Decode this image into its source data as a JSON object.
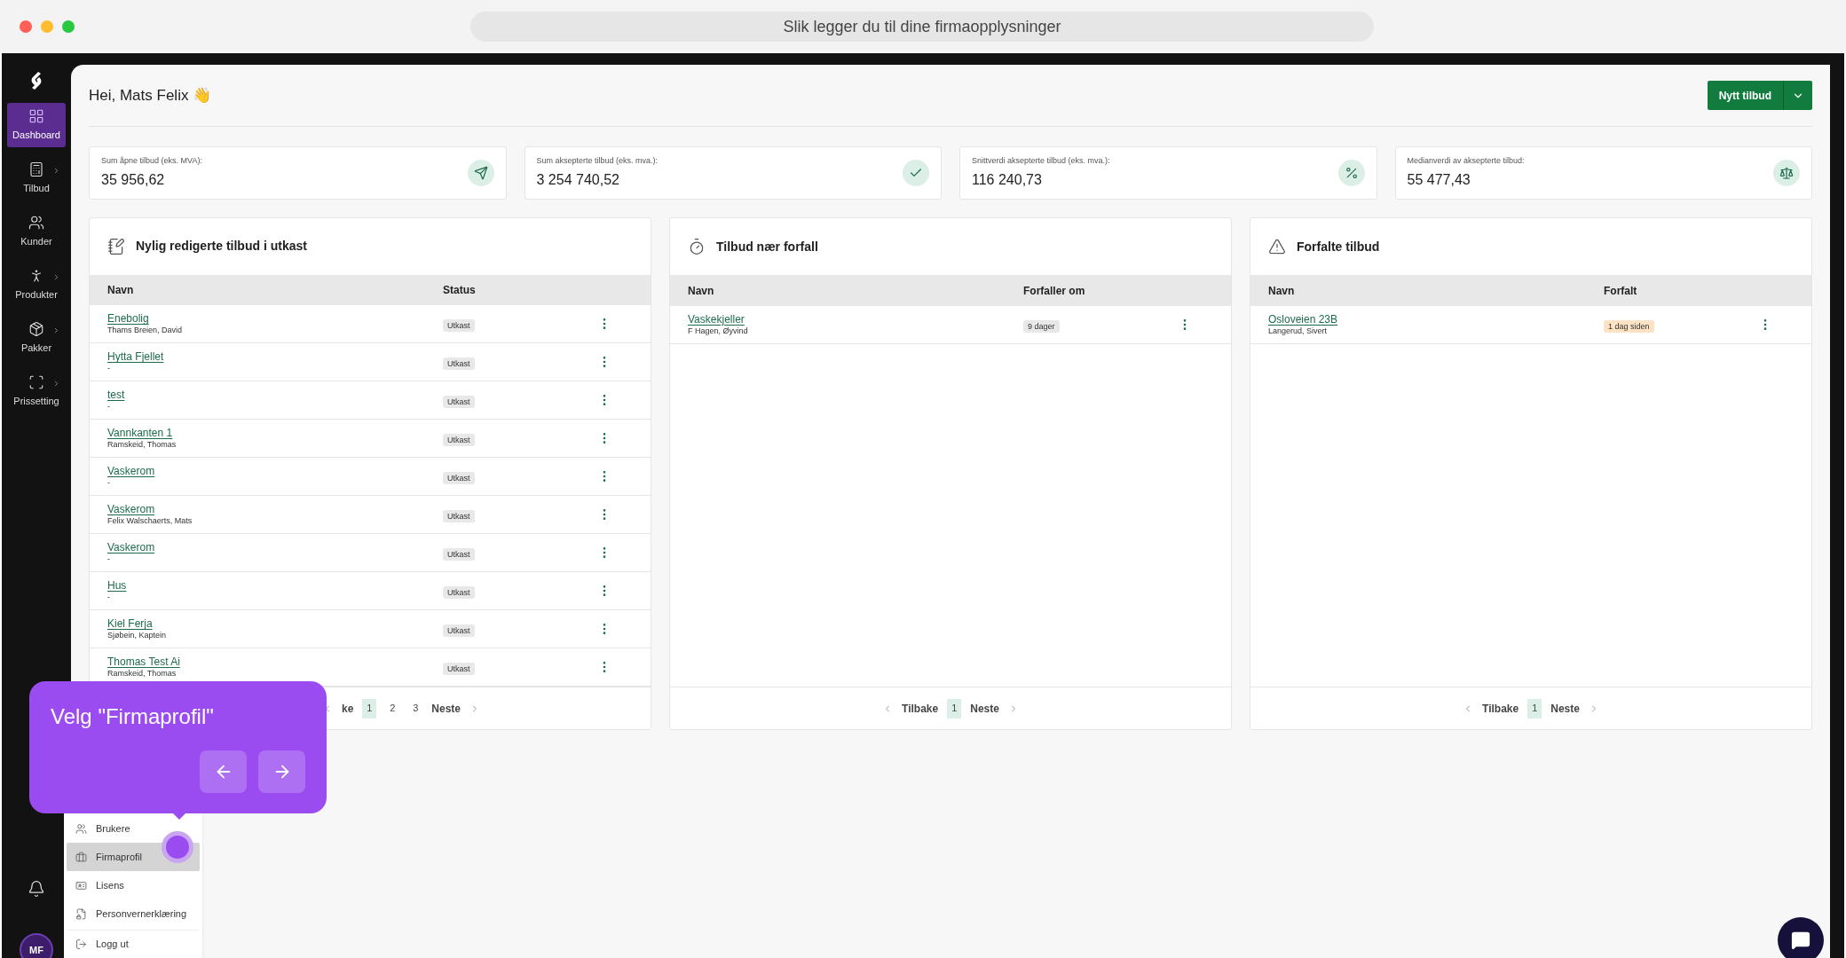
{
  "browser": {
    "address": "Slik legger du til dine firmaopplysninger"
  },
  "sidebar": {
    "items": [
      {
        "label": "Dashboard",
        "selected": true,
        "has_submenu": false
      },
      {
        "label": "Tilbud",
        "selected": false,
        "has_submenu": true
      },
      {
        "label": "Kunder",
        "selected": false,
        "has_submenu": false
      },
      {
        "label": "Produkter",
        "selected": false,
        "has_submenu": true
      },
      {
        "label": "Pakker",
        "selected": false,
        "has_submenu": true
      },
      {
        "label": "Prissetting",
        "selected": false,
        "has_submenu": true
      }
    ],
    "avatar": "MF"
  },
  "header": {
    "greeting": "Hei, Mats Felix 👋",
    "primary_button": "Nytt tilbud"
  },
  "stats": [
    {
      "label": "Sum åpne tilbud (eks. MVA):",
      "value": "35 956,62"
    },
    {
      "label": "Sum aksepterte tilbud (eks. mva.):",
      "value": "3 254 740,52"
    },
    {
      "label": "Snittverdi aksepterte tilbud (eks. mva.):",
      "value": "116 240,73"
    },
    {
      "label": "Medianverdi av aksepterte tilbud:",
      "value": "55 477,43"
    }
  ],
  "tables": [
    {
      "title": "Nylig redigerte tilbud i utkast",
      "columns": [
        "Navn",
        "Status"
      ],
      "rows": [
        {
          "name": "Enebolig",
          "sub": "Thams Breien, David",
          "status": "Utkast",
          "color": "#e8e8e8"
        },
        {
          "name": "Hytta Fjellet",
          "sub": "-",
          "status": "Utkast",
          "color": "#e8e8e8"
        },
        {
          "name": "test",
          "sub": "-",
          "status": "Utkast",
          "color": "#e8e8e8"
        },
        {
          "name": "Vannkanten 1",
          "sub": "Ramskeid, Thomas",
          "status": "Utkast",
          "color": "#e8e8e8"
        },
        {
          "name": "Vaskerom",
          "sub": "-",
          "status": "Utkast",
          "color": "#e8e8e8"
        },
        {
          "name": "Vaskerom",
          "sub": "Felix Walschaerts, Mats",
          "status": "Utkast",
          "color": "#e8e8e8"
        },
        {
          "name": "Vaskerom",
          "sub": "-",
          "status": "Utkast",
          "color": "#e8e8e8"
        },
        {
          "name": "Hus",
          "sub": "-",
          "status": "Utkast",
          "color": "#e8e8e8"
        },
        {
          "name": "Kiel Ferja",
          "sub": "Sjøbein, Kaptein",
          "status": "Utkast",
          "color": "#e8e8e8"
        },
        {
          "name": "Thomas Test Ai",
          "sub": "Ramskeid, Thomas",
          "status": "Utkast",
          "color": "#e8e8e8"
        }
      ],
      "pagination": {
        "prev": "ke",
        "pages": [
          {
            "label": "1",
            "selected": true
          },
          {
            "label": "2",
            "selected": false
          },
          {
            "label": "3",
            "selected": false
          }
        ],
        "next": "Neste"
      }
    },
    {
      "title": "Tilbud nær forfall",
      "columns": [
        "Navn",
        "Forfaller om"
      ],
      "rows": [
        {
          "name": "Vaskekjeller",
          "sub": "F Hagen, Øyvind",
          "status": "9 dager",
          "color": "#e8e8e8"
        }
      ],
      "pagination": {
        "prev": "Tilbake",
        "pages": [
          {
            "label": "1",
            "selected": true
          }
        ],
        "next": "Neste"
      }
    },
    {
      "title": "Forfalte tilbud",
      "columns": [
        "Navn",
        "Forfalt"
      ],
      "rows": [
        {
          "name": "Osloveien 23B",
          "sub": "Langerud, Sivert",
          "status": "1 dag siden",
          "color": "#fde3c3"
        }
      ],
      "pagination": {
        "prev": "Tilbake",
        "pages": [
          {
            "label": "1",
            "selected": true
          }
        ],
        "next": "Neste"
      }
    }
  ],
  "menu": {
    "items": [
      {
        "label": "Brukere",
        "selected": false,
        "kind": "item"
      },
      {
        "label": "Firmaprofil",
        "selected": true,
        "kind": "item"
      },
      {
        "label": "Lisens",
        "selected": false,
        "kind": "item"
      },
      {
        "label": "Personvernerklæring",
        "selected": false,
        "kind": "item"
      },
      {
        "label": "Logg ut",
        "selected": false,
        "kind": "logout"
      }
    ]
  },
  "tour": {
    "text": "Velg \"Firmaprofil\""
  }
}
